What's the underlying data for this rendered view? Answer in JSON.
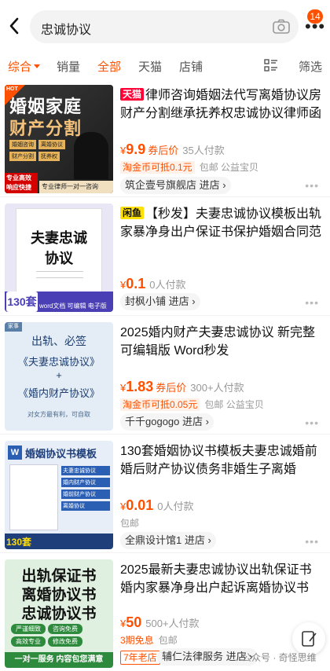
{
  "header": {
    "search_query": "忠诚协议",
    "notification_count": "14"
  },
  "sortbar": {
    "items": [
      "综合",
      "销量",
      "全部",
      "天猫",
      "店铺"
    ],
    "filter_label": "筛选"
  },
  "products": [
    {
      "tag": "天猫",
      "title": "律师咨询婚姻法代写离婚协议房财产分割继承抚养权忠诚协议律师函",
      "currency": "¥",
      "price": "9.9",
      "price_note": "券后价",
      "sold": "35人付款",
      "promo": "淘金币可抵0.1元",
      "extra": "包邮  公益宝贝",
      "shop": "筑企壹号旗舰店 进店 ›",
      "thumb": {
        "line1": "婚姻家庭",
        "line2": "财产分割",
        "bullets": [
          "婚姻咨询",
          "离婚协议",
          "财产分割",
          "抚养权"
        ],
        "footer_left": "专业高效 响应快捷",
        "footer_right": "专业律师一对一咨询",
        "hot": "HOT"
      }
    },
    {
      "tag": "闲鱼",
      "title": "【秒发】夫妻忠诚协议模板出轨家暴净身出户保证书保护婚姻合同范",
      "currency": "¥",
      "price": "0.1",
      "price_note": "",
      "sold": "0人付款",
      "promo": "",
      "extra": "",
      "shop": "封枫小铺 进店 ›",
      "thumb": {
        "line1": "夫妻忠诚",
        "line2": "协议",
        "count": "130套",
        "footer": "word文档 可编辑 电子版"
      }
    },
    {
      "tag": "",
      "title": "2025婚内财产夫妻忠诚协议 新完整可编辑版 Word秒发",
      "currency": "¥",
      "price": "1.83",
      "price_note": "券后价",
      "sold": "300+人付款",
      "promo": "淘金币可抵0.05元",
      "extra": "包邮  公益宝贝",
      "shop": "千千gogogo 进店 ›",
      "thumb": {
        "corner": "家事",
        "top": "出轨、必签",
        "book1": "《夫妻忠诚协议》",
        "plus": "+",
        "book2": "《婚内财产协议》",
        "footer": "对女方最有利，可自取"
      }
    },
    {
      "tag": "",
      "title": "130套婚姻协议书模板夫妻忠诚婚前 婚后财产协议债务非婚生子离婚",
      "currency": "¥",
      "price": "0.01",
      "price_note": "",
      "sold": "0人付款",
      "promo": "",
      "extra": "包邮",
      "shop": "全鼎设计馆1 进店 ›",
      "thumb": {
        "headline": "婚姻协议书模板",
        "count": "130套",
        "items": [
          "夫妻忠诚协议",
          "婚内财产协议",
          "婚前财产协议",
          "离婚协议"
        ]
      }
    },
    {
      "tag": "",
      "title": "2025最新夫妻忠诚协议出轨保证书婚内家暴净身出户起诉离婚协议书",
      "currency": "¥",
      "price": "50",
      "price_note": "",
      "sold": "500+人付款",
      "promo": "3期免息",
      "extra": "包邮",
      "shop": "辅仁法律服务 进店 ›",
      "shop_badge": "7年老店",
      "thumb": {
        "l1": "出轨保证书",
        "l2": "离婚协议书",
        "l3": "忠诚协议书",
        "pills": [
          "严谨细致",
          "咨询免费",
          "高效专业",
          "修改免费"
        ],
        "footer": "一对一服务 内容包您满意"
      }
    }
  ],
  "watermark": "公众号 · 奇怪思维"
}
